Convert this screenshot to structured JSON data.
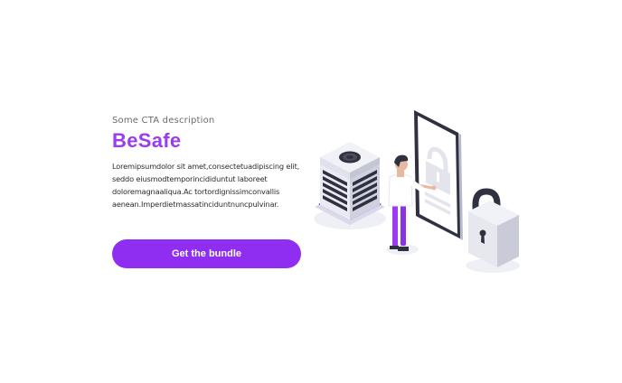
{
  "cta": {
    "eyebrow": "Some CTA  description",
    "title": "BeSafe",
    "description": "Loremipsumdolor sit amet,consectetuadipiscing elit, seddo eiusmodtemporincididuntut laboreet doloremagnaaliqua.Ac tortordignissimconvallis aenean.Imperdietmassatinciduntnuncpulvinar.",
    "button_label": "Get the bundle"
  },
  "illustration": {
    "icons": [
      "server-icon",
      "person-icon",
      "smartphone-icon",
      "padlock-icon"
    ]
  },
  "colors": {
    "accent": "#8f2ef0",
    "title": "#9a3cf2",
    "dark": "#2f3140",
    "light_gray": "#e6e7ef"
  }
}
